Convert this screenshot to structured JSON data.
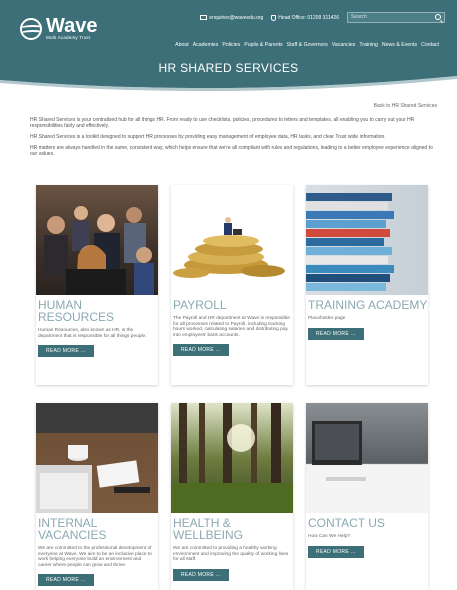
{
  "header": {
    "logo_word": "Wave",
    "logo_sub": "Multi Academy Trust",
    "email": "enquiries@waveedu.org",
    "phone": "Head Office: 01209 311426",
    "search_placeholder": "Search"
  },
  "nav": [
    "About",
    "Academies",
    "Policies",
    "Pupils & Parents",
    "Staff & Governors",
    "Vacancies",
    "Training",
    "News & Events",
    "Contact"
  ],
  "banner": {
    "title": "HR SHARED SERVICES"
  },
  "breadcrumb": "Back to HR Shared Services",
  "intro": [
    "HR Shared Services is your centralised hub for all things HR. From ready to use checklists, policies, procedures to letters and templates, all enabling you to carry out your HR responsibilities fairly and effectively.",
    "HR Shared Services is a toolkit designed to support HR processes by providing easy management of employee data, HR tasks, and clear Trust wide information.",
    "HR matters are always handled in the same, consistent way, which helps ensure that we're all compliant with rules and regulations, leading to a better employee experience aligned to our values."
  ],
  "cards": [
    {
      "title": "HUMAN RESOURCES",
      "desc": "Human Resources, also known as HR, is the department that is responsible for all things people.",
      "button": "READ MORE ..."
    },
    {
      "title": "PAYROLL",
      "desc": "The Payroll and HR department at Wave is responsible for all processes related to Payroll, including tracking hours worked, calculating salaries and distributing pay into employees' bank accounts.",
      "button": "READ MORE ..."
    },
    {
      "title": "TRAINING ACADEMY",
      "desc": "Placeholder page",
      "button": "READ MORE ..."
    },
    {
      "title": "INTERNAL VACANCIES",
      "desc": "We are committed to the professional development of everyone at Wave. We aim to be an inclusive place to work helping everyone build an environment and career where people can grow and thrive.",
      "button": "READ MORE ..."
    },
    {
      "title": "HEALTH & WELLBEING",
      "desc": "We are committed to providing a healthy working environment and improving the quality of working lives for all staff.",
      "button": "READ MORE ..."
    },
    {
      "title": "CONTACT US",
      "desc": "How Can We Help?",
      "button": "READ MORE ..."
    }
  ]
}
